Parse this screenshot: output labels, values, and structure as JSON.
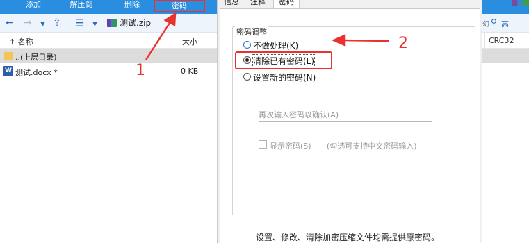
{
  "toolbar": {
    "buttons": [
      {
        "label": "添加"
      },
      {
        "label": "解压到"
      },
      {
        "label": "删除"
      },
      {
        "label": "密码"
      }
    ]
  },
  "addressbar": {
    "archive_name": "测试.zip",
    "icons": [
      "back-arrow-icon",
      "forward-arrow-icon",
      "dropdown-icon",
      "up-folder-icon",
      "list-view-icon",
      "dropdown-icon",
      "zip-archive-icon"
    ]
  },
  "file_list": {
    "columns": {
      "name": "名称",
      "size": "大小"
    },
    "rows": [
      {
        "name": "..(上层目录)",
        "size": "",
        "icon": "folder-icon"
      },
      {
        "name": "测试.docx *",
        "size": "0 KB",
        "icon": "word-document-icon"
      }
    ]
  },
  "right_panel": {
    "snippet_left": "幻",
    "snippet_right": "高",
    "column": "CRC32"
  },
  "dialog": {
    "tabs": [
      "信息",
      "注释",
      "密码"
    ],
    "active_tab": "密码",
    "group_title": "密码调整",
    "options": [
      {
        "label": "不做处理(K)",
        "selected": false
      },
      {
        "label": "清除已有密码(L)",
        "selected": true
      },
      {
        "label": "设置新的密码(N)",
        "selected": false
      }
    ],
    "new_password_value": "",
    "confirm_label": "再次输入密码以确认(A)",
    "confirm_value": "",
    "show_password_label": "显示密码(S)",
    "show_password_checked": false,
    "show_password_note": "(勾选可支持中文密码输入)",
    "footer": "设置、修改、清除加密压缩文件均需提供原密码。"
  },
  "annotations": {
    "step1": "1",
    "step2": "2",
    "color": "#e8322f"
  },
  "colors": {
    "toolbar": "#2a8ee0",
    "accent": "#2b6bbf",
    "highlight_box": "#e8322f"
  }
}
